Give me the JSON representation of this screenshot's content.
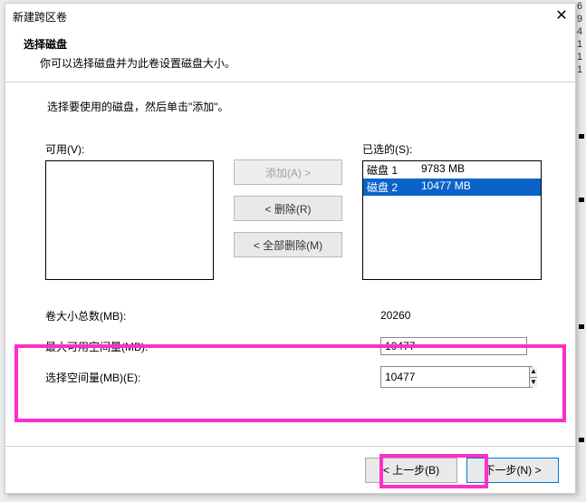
{
  "edge": {
    "nums": [
      "6",
      "9",
      "4",
      "1",
      "1",
      "1"
    ]
  },
  "dialog": {
    "title": "新建跨区卷",
    "header": {
      "title": "选择磁盘",
      "subtitle": "你可以选择磁盘并为此卷设置磁盘大小。"
    },
    "instruction": "选择要使用的磁盘，然后单击\"添加\"。",
    "available": {
      "label": "可用(V):",
      "items": []
    },
    "buttons": {
      "add": "添加(A)  >",
      "remove": "<  删除(R)",
      "remove_all": "<  全部删除(M)"
    },
    "selected": {
      "label": "已选的(S):",
      "items": [
        {
          "name": "磁盘 1",
          "size": "9783 MB",
          "selected": false
        },
        {
          "name": "磁盘 2",
          "size": "10477 MB",
          "selected": true
        }
      ]
    },
    "fields": {
      "total_label": "卷大小总数(MB):",
      "total_value": "20260",
      "max_label": "最大可用空间量(MB):",
      "max_value": "10477",
      "sel_label": "选择空间量(MB)(E):",
      "sel_value": "10477"
    },
    "nav": {
      "back": "< 上一步(B)",
      "next": "下一步(N) >"
    }
  }
}
